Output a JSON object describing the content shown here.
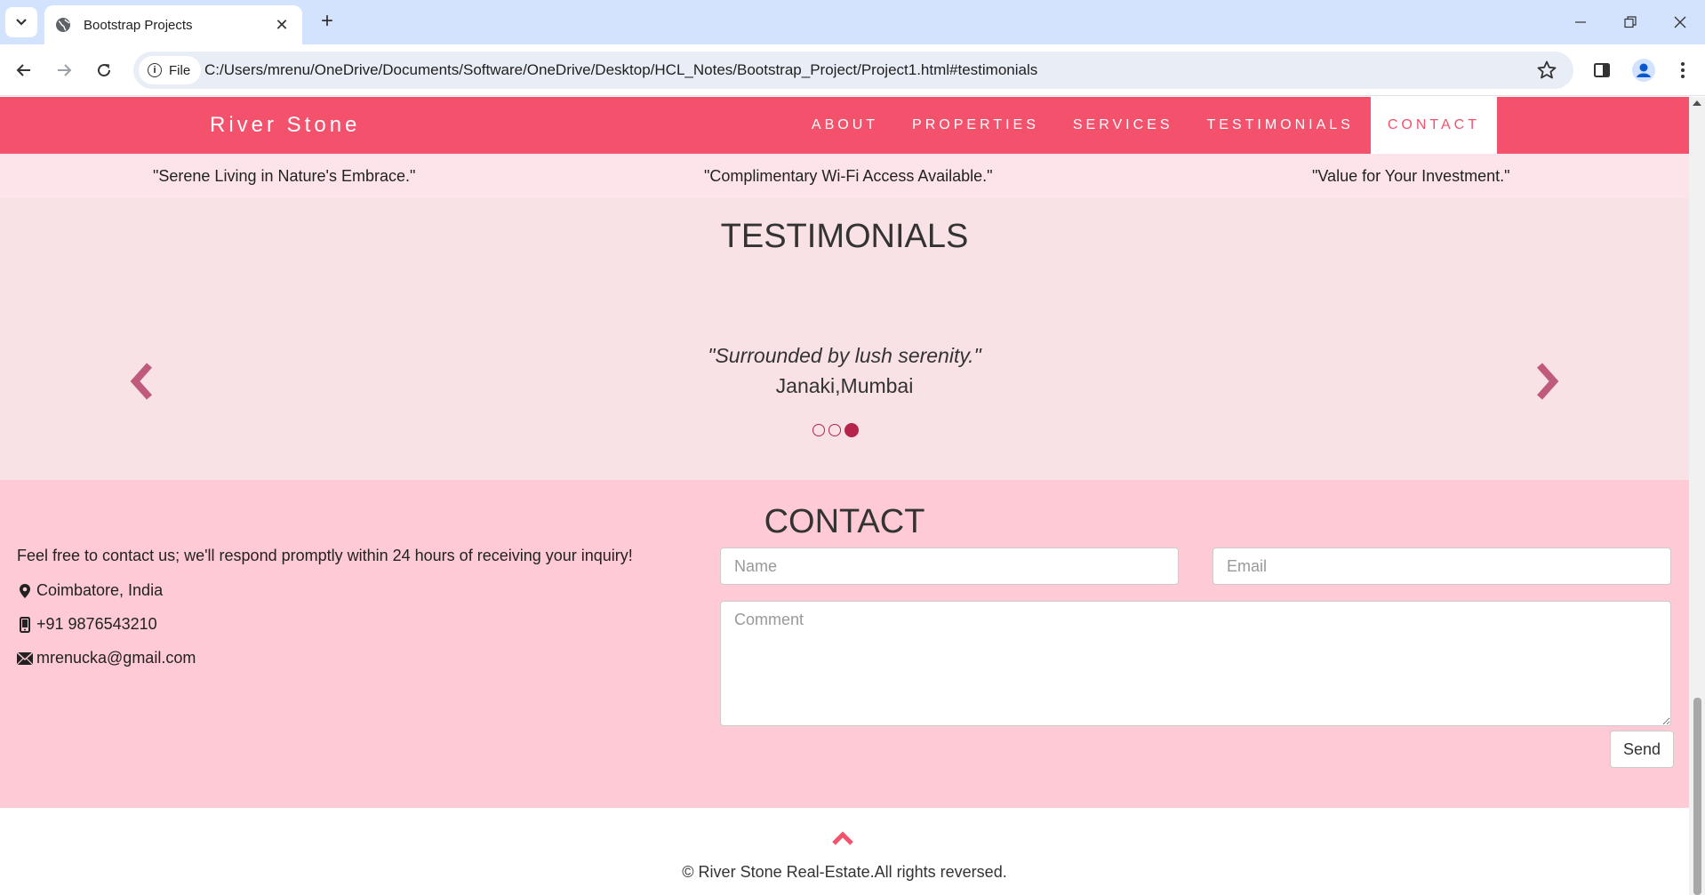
{
  "browser": {
    "tab_title": "Bootstrap Projects",
    "new_tab": "+",
    "close_tab": "✕",
    "chip_label": "File",
    "url": "C:/Users/mrenu/OneDrive/Documents/Software/OneDrive/Desktop/HCL_Notes/Bootstrap_Project/Project1.html#testimonials",
    "window_controls": [
      "minimize-icon",
      "restore-icon",
      "close-icon"
    ]
  },
  "navbar": {
    "brand": "River Stone",
    "items": [
      {
        "label": "ABOUT"
      },
      {
        "label": "PROPERTIES"
      },
      {
        "label": "SERVICES"
      },
      {
        "label": "TESTIMONIALS"
      },
      {
        "label": "CONTACT",
        "active": true
      }
    ],
    "color": "#f4516c"
  },
  "quotes": [
    "\"Serene Living in Nature's Embrace.\"",
    "\"Complimentary Wi-Fi Access Available.\"",
    "\"Value for Your Investment.\""
  ],
  "testimonials": {
    "heading": "TESTIMONIALS",
    "quote": "\"Surrounded by lush serenity.\"",
    "author": "Janaki,Mumbai",
    "slide_count": 3,
    "active_slide": 3
  },
  "contact": {
    "heading": "CONTACT",
    "intro": "Feel free to contact us; we'll respond promptly within 24 hours of receiving your inquiry!",
    "location": "Coimbatore, India",
    "phone": "+91 9876543210",
    "email": "mrenucka@gmail.com",
    "name_placeholder": "Name",
    "email_placeholder": "Email",
    "comment_placeholder": "Comment",
    "send_label": "Send"
  },
  "footer": {
    "copyright": "© River Stone Real-Estate.All rights reversed."
  }
}
